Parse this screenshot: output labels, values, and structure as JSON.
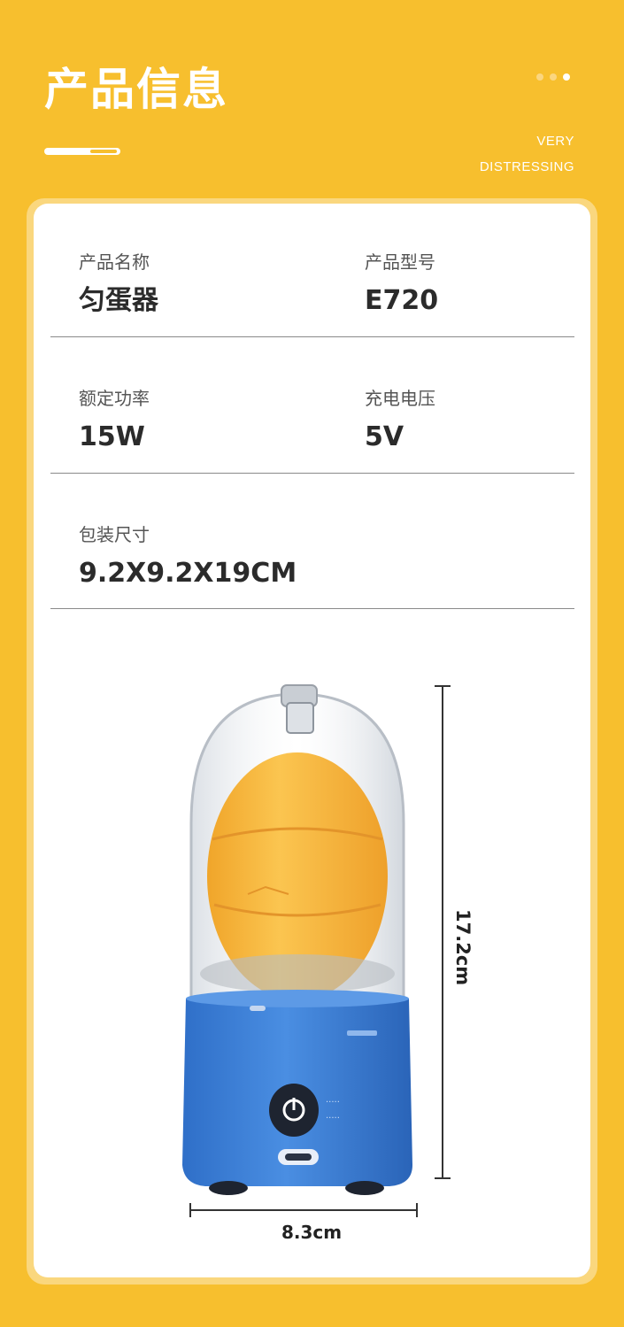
{
  "header": {
    "title": "产品信息",
    "tagline_line1": "VERY",
    "tagline_line2": "DISTRESSING"
  },
  "specs": {
    "product_name": {
      "label": "产品名称",
      "value": "匀蛋器"
    },
    "model": {
      "label": "产品型号",
      "value": "E720"
    },
    "rated_power": {
      "label": "额定功率",
      "value": "15W"
    },
    "charging_voltage": {
      "label": "充电电压",
      "value": "5V"
    },
    "package_size": {
      "label": "包装尺寸",
      "value": "9.2X9.2X19CM"
    }
  },
  "dimensions": {
    "height": "17.2cm",
    "width": "8.3cm"
  },
  "colors": {
    "background": "#f7bf2e",
    "card": "#ffffff",
    "device_base": "#3b7fd6",
    "egg": "#f5b13a"
  }
}
